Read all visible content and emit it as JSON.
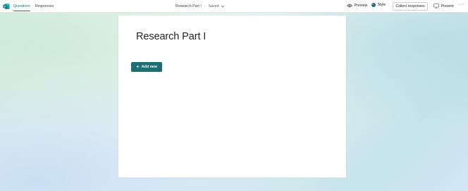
{
  "topbar": {
    "tabs": [
      {
        "label": "Questions",
        "active": true
      },
      {
        "label": "Responses",
        "active": false
      }
    ],
    "form_title": "Research Part I",
    "separator": "-",
    "saved_status": "Saved",
    "preview_label": "Preview",
    "style_label": "Style",
    "collect_label": "Collect responses",
    "present_label": "Present",
    "more_label": "···"
  },
  "form": {
    "title": "Research Part I",
    "add_new_label": "Add new"
  },
  "colors": {
    "accent": "#037f7f",
    "add_button": "#1f6f72",
    "brand_icon": "#03787c"
  },
  "icons": [
    "forms-app-icon",
    "chevron-down-icon",
    "eye-icon",
    "style-palette-icon",
    "present-icon",
    "more-icon",
    "plus-icon"
  ]
}
